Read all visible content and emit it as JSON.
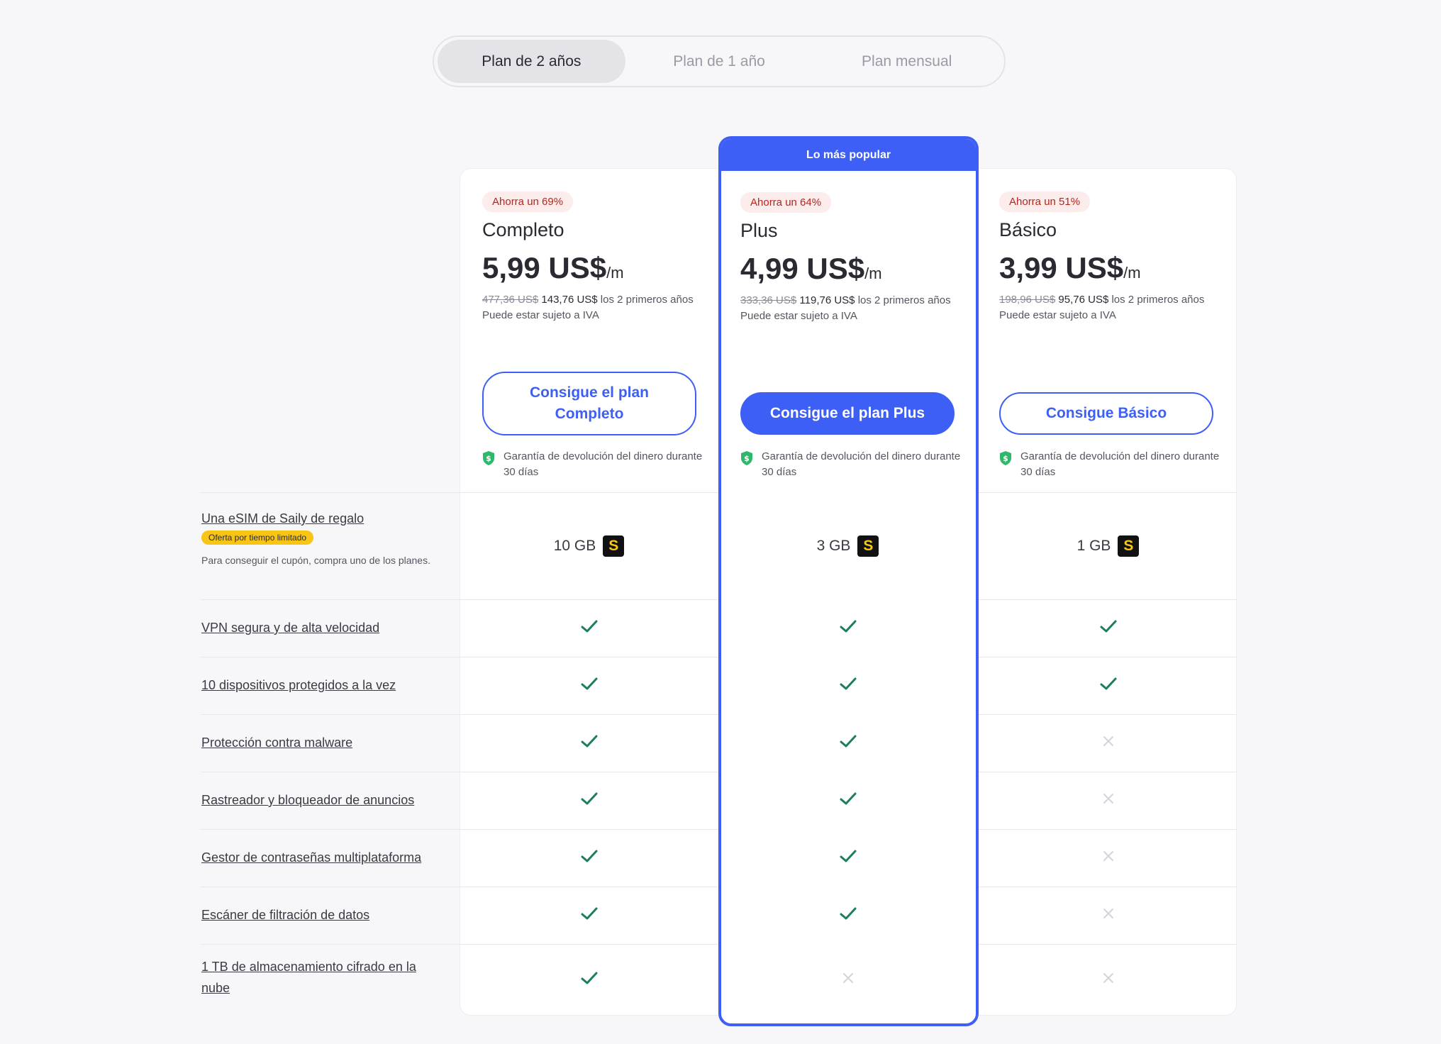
{
  "period_toggle": {
    "options": [
      "Plan de 2 años",
      "Plan de 1 año",
      "Plan mensual"
    ],
    "selected": "Plan de 2 años"
  },
  "plans": [
    {
      "discount": "Ahorra un 69%",
      "name": "Completo",
      "price": "5,99 US$",
      "per": "/m",
      "old_price": "477,36 US$",
      "new_price": "143,76 US$",
      "term": " los 2 primeros años",
      "vat": "Puede estar sujeto a IVA",
      "cta": "Consigue el plan Completo",
      "guarantee": "Garantía de devolución del dinero durante 30 días",
      "esim": "10 GB"
    },
    {
      "popular": "Lo más popular",
      "discount": "Ahorra un 64%",
      "name": "Plus",
      "price": "4,99 US$",
      "per": "/m",
      "old_price": "333,36 US$",
      "new_price": "119,76 US$",
      "term": " los 2 primeros años",
      "vat": "Puede estar sujeto a IVA",
      "cta": "Consigue el plan Plus",
      "guarantee": "Garantía de devolución del dinero durante 30 días",
      "esim": "3 GB"
    },
    {
      "discount": "Ahorra un 51%",
      "name": "Básico",
      "price": "3,99 US$",
      "per": "/m",
      "old_price": "198,96 US$",
      "new_price": "95,76 US$",
      "term": " los 2 primeros años",
      "vat": "Puede estar sujeto a IVA",
      "cta": "Consigue Básico",
      "guarantee": "Garantía de devolución del dinero durante 30 días",
      "esim": "1 GB"
    }
  ],
  "esim_row": {
    "label": "Una eSIM de Saily de regalo",
    "badge": "Oferta por tiempo limitado",
    "note": "Para conseguir el cupón, compra uno de los planes.",
    "icon_letter": "S"
  },
  "features": [
    {
      "label": "VPN segura y de alta velocidad",
      "included": [
        true,
        true,
        true
      ]
    },
    {
      "label": "10 dispositivos protegidos a la vez",
      "included": [
        true,
        true,
        true
      ]
    },
    {
      "label": "Protección contra malware",
      "included": [
        true,
        true,
        false
      ]
    },
    {
      "label": "Rastreador y bloqueador de anuncios",
      "included": [
        true,
        true,
        false
      ]
    },
    {
      "label": "Gestor de contraseñas multiplataforma",
      "included": [
        true,
        true,
        false
      ]
    },
    {
      "label": "Escáner de filtración de datos",
      "included": [
        true,
        true,
        false
      ]
    },
    {
      "label": "1 TB de almacenamiento cifrado en la nube",
      "included": [
        true,
        false,
        false
      ]
    }
  ],
  "colors": {
    "accent": "#3e5ff5",
    "check": "#1a7f5a",
    "cross": "#d4d4da",
    "badge_red_bg": "#fdecec",
    "limited_badge": "#f8c514"
  },
  "icons": {
    "check": "check-icon",
    "cross": "cross-icon",
    "guarantee": "shield-dollar-icon",
    "saily": "saily-logo-icon"
  }
}
